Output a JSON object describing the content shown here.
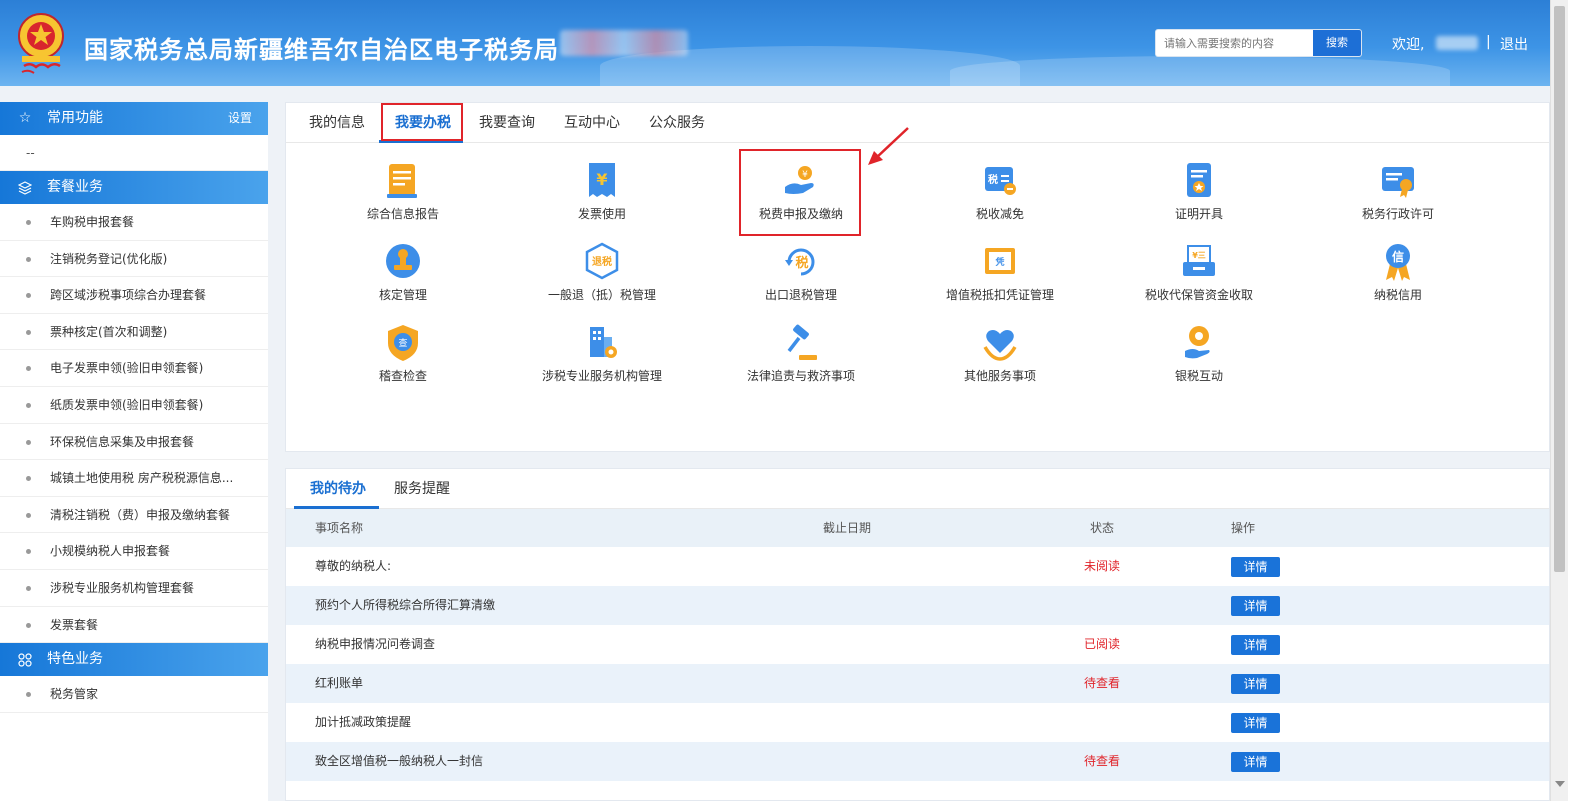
{
  "header": {
    "title": "国家税务总局新疆维吾尔自治区电子税务局",
    "search": {
      "placeholder": "请输入需要搜索的内容",
      "button": "搜索"
    },
    "welcome": "欢迎,",
    "separator": "|",
    "logout": "退出"
  },
  "sidebar": {
    "common": {
      "title": "常用功能",
      "setting": "设置",
      "empty": "--"
    },
    "package": {
      "title": "套餐业务",
      "items": [
        "车购税申报套餐",
        "注销税务登记(优化版)",
        "跨区域涉税事项综合办理套餐",
        "票种核定(首次和调整)",
        "电子发票申领(验旧申领套餐)",
        "纸质发票申领(验旧申领套餐)",
        "环保税信息采集及申报套餐",
        "城镇土地使用税 房产税税源信息...",
        "清税注销税（费）申报及缴纳套餐",
        "小规模纳税人申报套餐",
        "涉税专业服务机构管理套餐",
        "发票套餐"
      ]
    },
    "special": {
      "title": "特色业务",
      "items": [
        "税务管家"
      ]
    }
  },
  "main": {
    "tabs": [
      "我的信息",
      "我要办税",
      "我要查询",
      "互动中心",
      "公众服务"
    ],
    "active_tab": "我要办税",
    "grid": [
      {
        "label": "综合信息报告",
        "icon": "report-icon"
      },
      {
        "label": "发票使用",
        "icon": "invoice-icon"
      },
      {
        "label": "税费申报及缴纳",
        "icon": "tax-payment-icon"
      },
      {
        "label": "税收减免",
        "icon": "tax-relief-icon"
      },
      {
        "label": "证明开具",
        "icon": "certificate-icon"
      },
      {
        "label": "税务行政许可",
        "icon": "license-icon"
      },
      {
        "label": "核定管理",
        "icon": "stamp-icon"
      },
      {
        "label": "一般退（抵）税管理",
        "icon": "refund-icon"
      },
      {
        "label": "出口退税管理",
        "icon": "export-refund-icon"
      },
      {
        "label": "增值税抵扣凭证管理",
        "icon": "voucher-icon"
      },
      {
        "label": "税收代保管资金收取",
        "icon": "fund-icon"
      },
      {
        "label": "纳税信用",
        "icon": "credit-icon"
      },
      {
        "label": "稽查检查",
        "icon": "inspection-icon"
      },
      {
        "label": "涉税专业服务机构管理",
        "icon": "agency-icon"
      },
      {
        "label": "法律追责与救济事项",
        "icon": "gavel-icon"
      },
      {
        "label": "其他服务事项",
        "icon": "heart-icon"
      },
      {
        "label": "银税互动",
        "icon": "bank-tax-icon"
      }
    ]
  },
  "todo": {
    "tabs": [
      "我的待办",
      "服务提醒"
    ],
    "columns": [
      "事项名称",
      "截止日期",
      "状态",
      "操作"
    ],
    "rows": [
      {
        "name": "尊敬的纳税人:",
        "date": "",
        "status": "未阅读",
        "action": "详情"
      },
      {
        "name": "预约个人所得税综合所得汇算清缴",
        "date": "",
        "status": "",
        "action": "详情"
      },
      {
        "name": "纳税申报情况问卷调查",
        "date": "",
        "status": "已阅读",
        "action": "详情"
      },
      {
        "name": "红利账单",
        "date": "",
        "status": "待查看",
        "action": "详情"
      },
      {
        "name": "加计抵减政策提醒",
        "date": "",
        "status": "",
        "action": "详情"
      },
      {
        "name": "致全区增值税一般纳税人一封信",
        "date": "",
        "status": "待查看",
        "action": "详情"
      }
    ]
  },
  "colors": {
    "primary": "#1a6fd1",
    "highlight": "#e0242a",
    "icon_orange": "#f5a623",
    "icon_blue": "#3d8ee8"
  }
}
